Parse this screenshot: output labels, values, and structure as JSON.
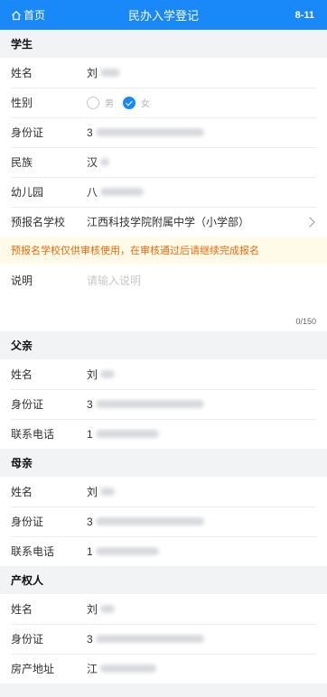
{
  "navbar": {
    "back_label": "首页",
    "title": "民办入学登记",
    "right_text": "8-11"
  },
  "student": {
    "header": "学生",
    "name_label": "姓名",
    "name_first": "刘",
    "gender_label": "性别",
    "gender_options": [
      "男",
      "女"
    ],
    "gender_selected": "女",
    "id_label": "身份证",
    "id_first": "3",
    "ethnicity_label": "民族",
    "ethnicity_first": "汉",
    "kindergarten_label": "幼儿园",
    "kindergarten_first": "八",
    "school_label": "预报名学校",
    "school_value": "江西科技学院附属中学（小学部）",
    "notice": "预报名学校仅供审核使用，在审核通过后请继续完成报名",
    "note_label": "说明",
    "note_placeholder": "请输入说明",
    "note_value": "",
    "note_counter": "0/150"
  },
  "father": {
    "header": "父亲",
    "name_label": "姓名",
    "name_first": "刘",
    "id_label": "身份证",
    "id_first": "3",
    "phone_label": "联系电话",
    "phone_first": "1"
  },
  "mother": {
    "header": "母亲",
    "name_label": "姓名",
    "name_first": "刘",
    "id_label": "身份证",
    "id_first": "3",
    "phone_label": "联系电话",
    "phone_first": "1"
  },
  "owner": {
    "header": "产权人",
    "name_label": "姓名",
    "name_first": "刘",
    "id_label": "身份证",
    "id_first": "3",
    "address_label": "房产地址",
    "address_first": "江"
  },
  "colors": {
    "primary": "#1989fa",
    "notice_text": "#ed6a0c",
    "notice_bg": "#fffbe8"
  }
}
